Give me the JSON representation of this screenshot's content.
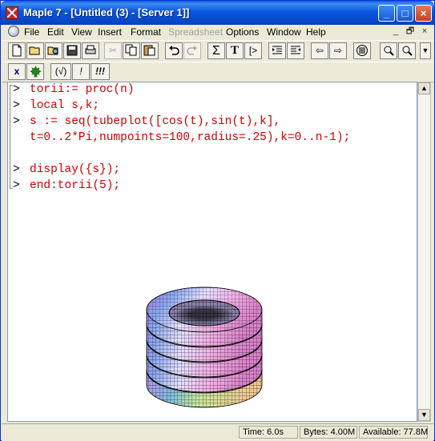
{
  "window": {
    "title": "Maple 7  - [Untitled (3) - [Server 1]]"
  },
  "title_buttons": {
    "minimize": "_",
    "maximize": "□",
    "close": "×"
  },
  "menu": {
    "items": [
      "File",
      "Edit",
      "View",
      "Insert",
      "Format",
      "Spreadsheet",
      "Options",
      "Window",
      "Help"
    ],
    "mdi": {
      "minimize": "_",
      "restore": "🗗",
      "close": "×"
    }
  },
  "toolbar2": {
    "x_label": "x",
    "b1": "(√)",
    "b2": "!",
    "b3": "!!!"
  },
  "worksheet": {
    "lines": [
      {
        "prompt": ">",
        "code": "torii:= proc(n)"
      },
      {
        "prompt": ">",
        "code": "local s,k;"
      },
      {
        "prompt": ">",
        "code": "s := seq(tubeplot([cos(t),sin(t),k],"
      },
      {
        "prompt": "",
        "code": "t=0..2*Pi,numpoints=100,radius=.25),k=0..n-1);"
      },
      {
        "prompt": ">",
        "code": "display({s});"
      },
      {
        "prompt": ">",
        "code": "end:torii(5);"
      }
    ]
  },
  "status": {
    "time": "Time:  6.0s",
    "bytes": "Bytes: 4.00M",
    "available": "Available: 77.8M"
  },
  "colors": {
    "input_text": "#d00000",
    "titlebar": "#0855dd"
  }
}
